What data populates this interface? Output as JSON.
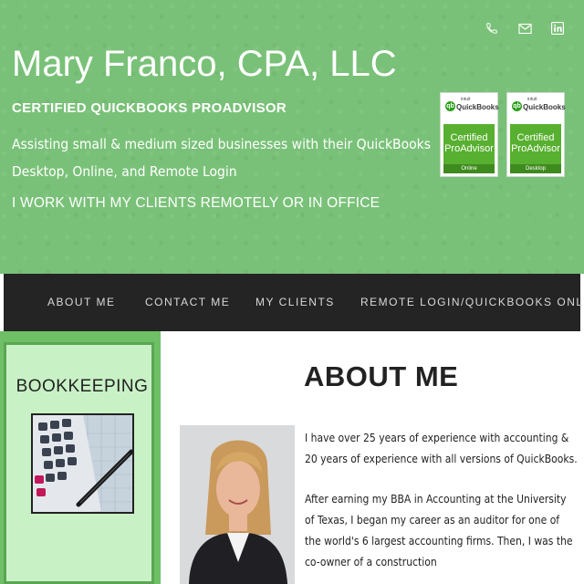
{
  "header": {
    "title": "Mary Franco, CPA, LLC",
    "subtitle": "CERTIFIED QUICKBOOKS PROADVISOR",
    "description": "Assisting small & medium sized businesses with their QuickBooks Desktop, Online, and Remote Login",
    "remote_note": "I WORK WITH MY CLIENTS REMOTELY OR IN OFFICE",
    "social_icons": [
      "phone-icon",
      "email-icon",
      "linkedin-icon"
    ]
  },
  "badges": [
    {
      "brand": "QuickBooks",
      "maker": "intuit",
      "line1": "Certified",
      "line2": "ProAdvisor",
      "type": "Online"
    },
    {
      "brand": "QuickBooks",
      "maker": "intuit",
      "line1": "Certified",
      "line2": "ProAdvisor",
      "type": "Desktop"
    }
  ],
  "nav": {
    "items": [
      "ABOUT ME",
      "CONTACT ME",
      "MY CLIENTS",
      "REMOTE LOGIN/QUICKBOOKS ONLINE"
    ]
  },
  "sidebar": {
    "title": "BOOKKEEPING"
  },
  "main": {
    "heading": "ABOUT ME",
    "paragraphs": [
      "I have over 25 years of experience with accounting & 20 years of experience with all versions of QuickBooks.",
      "After earning my BBA in Accounting at the University of Texas, I began my career as an auditor for one of the world's 6 largest accounting firms. Then, I was the co-owner of a construction"
    ]
  },
  "colors": {
    "header_green": "#79c178",
    "nav_bg": "#242424",
    "sidebar_bg": "#c9f1c6",
    "qb_green": "#2ca01c"
  }
}
